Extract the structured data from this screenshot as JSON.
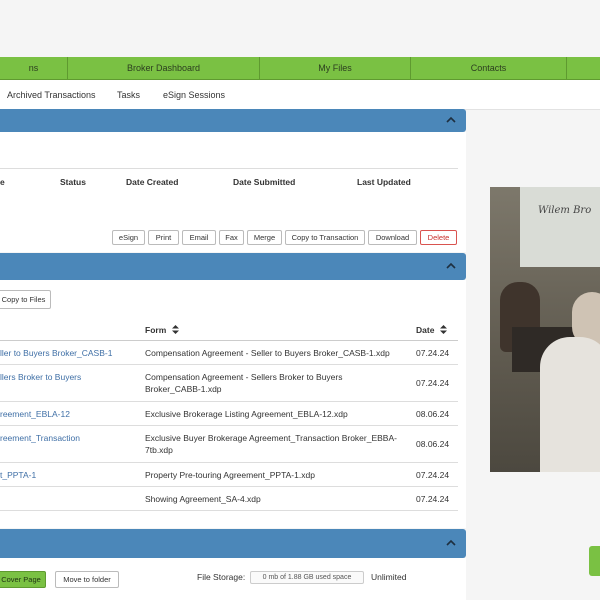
{
  "topnav": {
    "items": [
      {
        "label": "ns"
      },
      {
        "label": "Broker Dashboard"
      },
      {
        "label": "My Files"
      },
      {
        "label": "Contacts"
      }
    ]
  },
  "subnav": {
    "items": [
      {
        "label": "Archived Transactions"
      },
      {
        "label": "Tasks"
      },
      {
        "label": "eSign Sessions"
      }
    ]
  },
  "esign_table": {
    "headers": [
      "e",
      "Status",
      "Date Created",
      "Date Submitted",
      "Last Updated"
    ]
  },
  "actions": {
    "esign": "eSign",
    "print": "Print",
    "email": "Email",
    "fax": "Fax",
    "merge": "Merge",
    "copy_to_transaction": "Copy to Transaction",
    "download": "Download",
    "delete": "Delete"
  },
  "forms_section": {
    "copy_to_files": "Copy to Files",
    "headers": {
      "form": "Form",
      "date": "Date"
    },
    "rows": [
      {
        "name": "ller to Buyers Broker_CASB-1",
        "form": "Compensation Agreement - Seller to Buyers Broker_CASB-1.xdp",
        "date": "07.24.24"
      },
      {
        "name": "llers Broker to Buyers",
        "form": "Compensation Agreement - Sellers Broker to Buyers Broker_CABB-1.xdp",
        "date": "07.24.24"
      },
      {
        "name": "reement_EBLA-12",
        "form": "Exclusive Brokerage Listing Agreement_EBLA-12.xdp",
        "date": "08.06.24"
      },
      {
        "name": "reement_Transaction",
        "form": "Exclusive Buyer Brokerage Agreement_Transaction Broker_EBBA-7tb.xdp",
        "date": "08.06.24"
      },
      {
        "name": "t_PPTA-1",
        "form": "Property Pre-touring Agreement_PPTA-1.xdp",
        "date": "07.24.24"
      },
      {
        "name": "",
        "form": "Showing Agreement_SA-4.xdp",
        "date": "07.24.24"
      }
    ]
  },
  "files_section": {
    "cover_page": "Cover Page",
    "move_to_folder": "Move to folder",
    "storage_label": "File Storage:",
    "storage_value": "0 mb of 1.88 GB used space",
    "storage_limit": "Unlimited"
  },
  "video": {
    "board_text": "Wilem Bro"
  },
  "colors": {
    "nav_green": "#7ac143",
    "section_blue": "#4b87b9",
    "link_blue": "#3f6fa6",
    "delete_red": "#d9534f"
  }
}
